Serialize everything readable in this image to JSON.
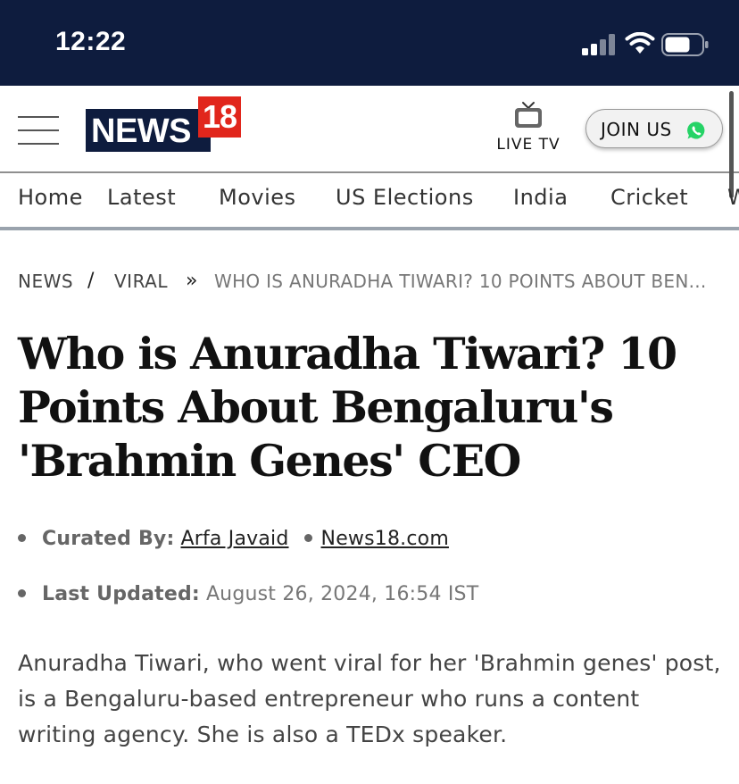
{
  "status_bar": {
    "time": "12:22"
  },
  "header": {
    "logo": {
      "text": "NEWS",
      "number": "18"
    },
    "live_tv_label": "LIVE TV",
    "join_label": "JOIN US"
  },
  "nav": {
    "items": [
      "Home",
      "Latest",
      "Movies",
      "US Elections",
      "India",
      "Cricket",
      "W"
    ]
  },
  "breadcrumb": {
    "items": [
      "NEWS",
      "VIRAL"
    ],
    "current": "WHO IS ANURADHA TIWARI? 10 POINTS ABOUT BEN..."
  },
  "article": {
    "title": "Who is Anuradha Tiwari? 10 Points About Bengaluru's 'Brahmin Genes' CEO",
    "curated_label": "Curated By:",
    "author": "Arfa Javaid",
    "source": "News18.com",
    "updated_label": "Last Updated:",
    "updated_value": "August 26, 2024, 16:54 IST",
    "summary": "Anuradha Tiwari, who went viral for her 'Brahmin genes' post, is a Bengaluru-based entrepreneur who runs a content writing agency. She is also a TEDx speaker."
  },
  "colors": {
    "brand_navy": "#0e1c3e",
    "brand_red": "#e1261c",
    "whatsapp_green": "#25d366"
  },
  "icons": [
    "signal-icon",
    "wifi-icon",
    "battery-icon",
    "hamburger-menu-icon",
    "tv-icon",
    "whatsapp-icon"
  ]
}
